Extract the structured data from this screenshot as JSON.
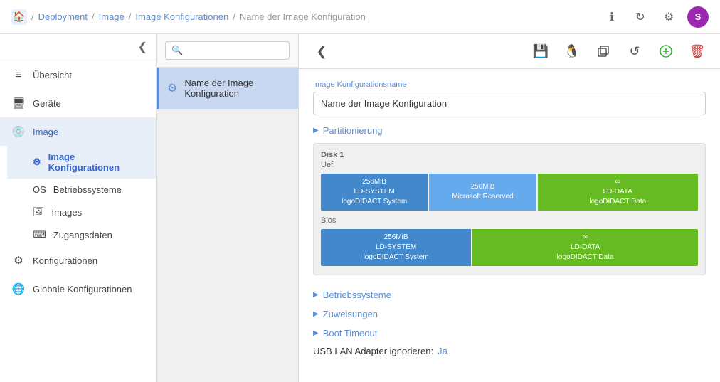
{
  "header": {
    "home_icon": "🏠",
    "breadcrumbs": [
      "Deployment",
      "Image",
      "Image Konfigurationen",
      "Name der Image Konfiguration"
    ],
    "icons": {
      "info": "ℹ",
      "refresh": "↻",
      "settings": "⚙",
      "user": "S"
    }
  },
  "sidebar": {
    "toggle_icon": "❮",
    "items": [
      {
        "label": "Übersicht",
        "icon": "≡",
        "id": "uebersicht"
      },
      {
        "label": "Geräte",
        "icon": "🖥",
        "id": "geraete"
      },
      {
        "label": "Image",
        "icon": "💿",
        "id": "image",
        "active": true
      },
      {
        "label": "Konfigurationen",
        "icon": "⚙",
        "id": "konfigurationen"
      },
      {
        "label": "Globale Konfigurationen",
        "icon": "🌐",
        "id": "globale"
      }
    ],
    "sub_items": [
      {
        "label": "Image Konfigurationen",
        "id": "image-konfigurationen",
        "active": true
      },
      {
        "label": "Betriebssysteme",
        "id": "betriebssysteme"
      },
      {
        "label": "Images",
        "id": "images"
      },
      {
        "label": "Zugangsdaten",
        "id": "zugangsdaten"
      }
    ]
  },
  "middle": {
    "search_placeholder": "",
    "config_item_label": "Name der Image\nKonfiguration"
  },
  "toolbar": {
    "back_icon": "❮",
    "save_icon": "💾",
    "linux_icon": "🐧",
    "copy_icon": "⊡",
    "undo_icon": "↺",
    "add_icon": "⊕",
    "delete_icon": "🗑"
  },
  "content": {
    "field_label": "Image Konfigurationsname",
    "field_value": "Name der Image Konfiguration",
    "partitionierung_label": "Partitionierung",
    "disk1": {
      "title": "Disk 1",
      "type_uefi": "Uefi",
      "type_bios": "Bios",
      "uefi_parts": [
        {
          "label": "256MiB\nLD-SYSTEM\nlogoDIDACT System",
          "flex": 2,
          "color": "blue"
        },
        {
          "label": "256MiB\nMicrosoft Reserved",
          "flex": 2,
          "color": "blue-light"
        },
        {
          "label": "∞\nLD-DATA\nlogoDIDACT Data",
          "flex": 3,
          "color": "green"
        }
      ],
      "bios_parts": [
        {
          "label": "256MiB\nLD-SYSTEM\nlogoDIDACT System",
          "flex": 2,
          "color": "blue"
        },
        {
          "label": "∞\nLD-DATA\nlogoDIDACT Data",
          "flex": 3,
          "color": "green"
        }
      ]
    },
    "sections": [
      {
        "label": "Betriebssysteme",
        "id": "betriebssysteme"
      },
      {
        "label": "Zuweisungen",
        "id": "zuweisungen"
      },
      {
        "label": "Boot Timeout",
        "id": "boot-timeout"
      }
    ],
    "usb_label": "USB LAN Adapter ignorieren:",
    "usb_value": "Ja"
  }
}
